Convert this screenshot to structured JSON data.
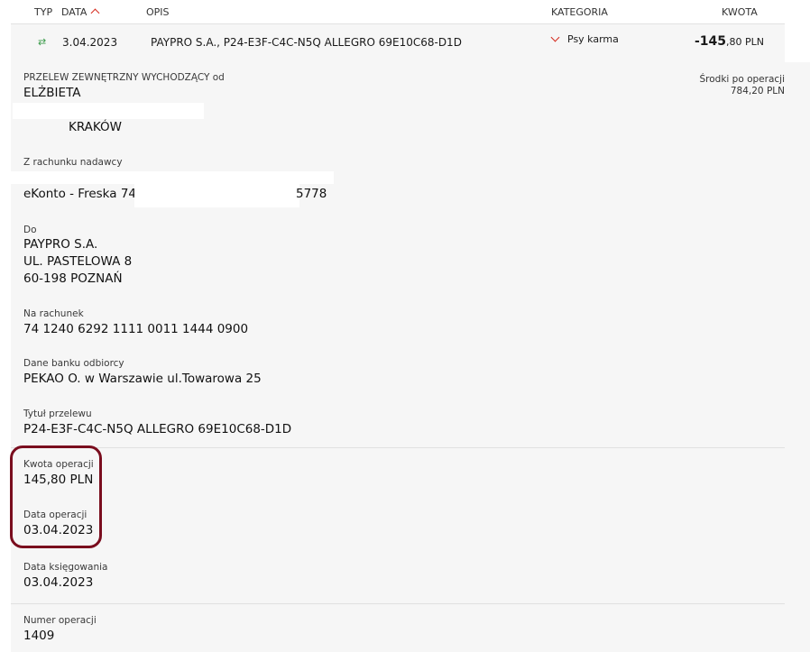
{
  "header": {
    "typ": "TYP",
    "data": "DATA",
    "opis": "OPIS",
    "kategoria": "KATEGORIA",
    "kwota": "KWOTA"
  },
  "transaction": {
    "date": "3.04.2023",
    "description": "PAYPRO S.A., P24-E3F-C4C-N5Q ALLEGRO 69E10C68-D1D",
    "category": "Psy karma",
    "amount_int": "-145",
    "amount_dec": ",80 PLN"
  },
  "details": {
    "type_line": "PRZELEW ZEWNĘTRZNY WYCHODZĄCY od",
    "sender_name": "ELŻBIETA",
    "sender_city": "KRAKÓW",
    "balance_label": "Środki po operacji",
    "balance_value": "784,20 PLN",
    "from_account_label": "Z rachunku nadawcy",
    "from_account_prefix": "eKonto - Freska 74",
    "from_account_suffix": "5778",
    "to_label": "Do",
    "to_line1": "PAYPRO S.A.",
    "to_line2": "UL. PASTELOWA 8",
    "to_line3": "60-198 POZNAŃ",
    "account_label": "Na rachunek",
    "account_value": "74 1240 6292 1111 0011 1444 0900",
    "bank_label": "Dane banku odbiorcy",
    "bank_value": "PEKAO O. w Warszawie ul.Towarowa 25",
    "title_label": "Tytuł przelewu",
    "title_value": "P24-E3F-C4C-N5Q ALLEGRO 69E10C68-D1D",
    "op_amount_label": "Kwota operacji",
    "op_amount_value": "145,80 PLN",
    "op_date_label": "Data operacji",
    "op_date_value": "03.04.2023",
    "booking_date_label": "Data księgowania",
    "booking_date_value": "03.04.2023",
    "op_number_label": "Numer operacji",
    "op_number_value": "1409"
  },
  "colors": {
    "accent_red": "#d52b1e",
    "transfer_green": "#3a9b4a",
    "highlight": "#7a0d1e"
  },
  "icons": {
    "sort": "arrow-up-icon",
    "type": "transfer-icon",
    "category": "chevron-down-icon"
  }
}
